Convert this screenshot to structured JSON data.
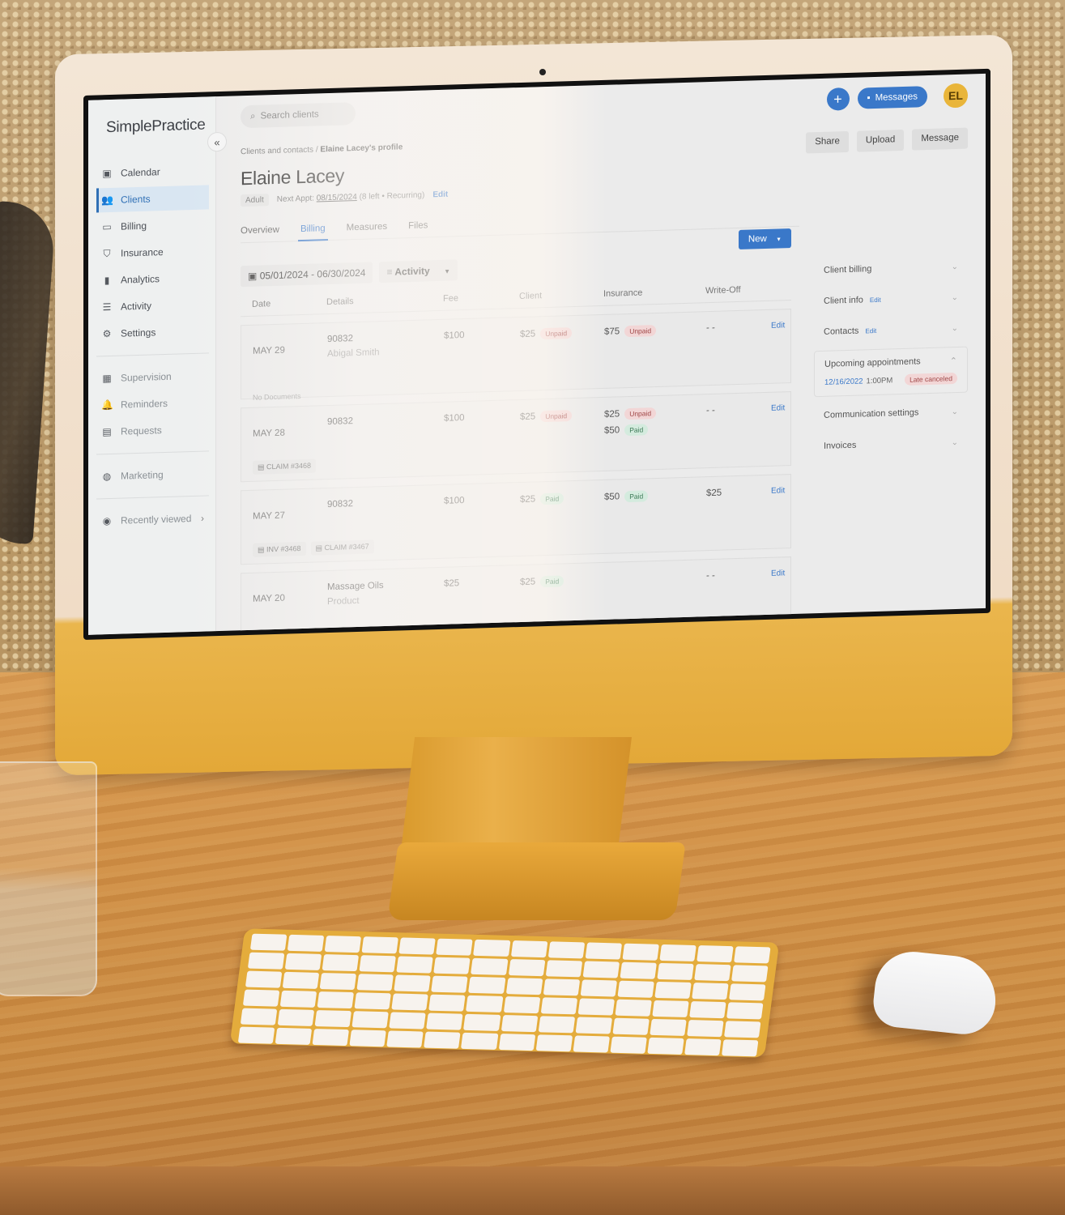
{
  "app": {
    "logo": "SimplePractice",
    "collapse_icon": "«",
    "search_placeholder": "Search clients",
    "add_label": "+",
    "messages_label": "Messages",
    "avatar_initials": "EL"
  },
  "sidebar": {
    "primary": [
      {
        "label": "Calendar",
        "icon": "▣",
        "active": false
      },
      {
        "label": "Clients",
        "icon": "👥",
        "active": true
      },
      {
        "label": "Billing",
        "icon": "▭",
        "active": false
      },
      {
        "label": "Insurance",
        "icon": "⛉",
        "active": false
      },
      {
        "label": "Analytics",
        "icon": "▮",
        "active": false
      },
      {
        "label": "Activity",
        "icon": "☰",
        "active": false
      },
      {
        "label": "Settings",
        "icon": "⚙",
        "active": false
      }
    ],
    "secondary": [
      {
        "label": "Supervision",
        "icon": "▦"
      },
      {
        "label": "Reminders",
        "icon": "🔔"
      },
      {
        "label": "Requests",
        "icon": "▤"
      }
    ],
    "marketing": {
      "label": "Marketing",
      "icon": "◍"
    },
    "recently_viewed": {
      "label": "Recently viewed",
      "icon": "◉",
      "chevron": "›"
    }
  },
  "profile": {
    "breadcrumb": {
      "parent": "Clients and contacts",
      "separator": "/",
      "current": "Elaine Lacey's profile"
    },
    "name": "Elaine Lacey",
    "tag": "Adult",
    "next_appt_label": "Next Appt:",
    "next_appt_date": "08/15/2024",
    "next_appt_note": "(8 left • Recurring)",
    "edit_label": "Edit",
    "actions": {
      "share": "Share",
      "upload": "Upload",
      "message": "Message"
    },
    "tabs": [
      {
        "label": "Overview",
        "active": false
      },
      {
        "label": "Billing",
        "active": true
      },
      {
        "label": "Measures",
        "active": false
      },
      {
        "label": "Files",
        "active": false
      }
    ]
  },
  "billing": {
    "date_range": "05/01/2024 - 06/30/2024",
    "filter_label": "Activity",
    "new_label": "New",
    "columns": [
      "Date",
      "Details",
      "Fee",
      "Client",
      "Insurance",
      "Write-Off",
      ""
    ],
    "rows": [
      {
        "date": "MAY 29",
        "details": "90832",
        "details_sub": "Abigal Smith",
        "fee": "$100",
        "client": [
          {
            "amount": "$25",
            "status": "Unpaid"
          }
        ],
        "insurance": [
          {
            "amount": "$75",
            "status": "Unpaid"
          }
        ],
        "write_off": "- -",
        "edit": "Edit",
        "docs": [],
        "no_docs": "No Documents"
      },
      {
        "date": "MAY 28",
        "details": "90832",
        "details_sub": "",
        "fee": "$100",
        "client": [
          {
            "amount": "$25",
            "status": "Unpaid"
          }
        ],
        "insurance": [
          {
            "amount": "$25",
            "status": "Unpaid"
          },
          {
            "amount": "$50",
            "status": "Paid"
          }
        ],
        "write_off": "- -",
        "edit": "Edit",
        "docs": [
          "CLAIM #3468"
        ],
        "no_docs": ""
      },
      {
        "date": "MAY 27",
        "details": "90832",
        "details_sub": "",
        "fee": "$100",
        "client": [
          {
            "amount": "$25",
            "status": "Paid"
          }
        ],
        "insurance": [
          {
            "amount": "$50",
            "status": "Paid"
          }
        ],
        "write_off": "$25",
        "edit": "Edit",
        "docs": [
          "INV #3468",
          "CLAIM #3467"
        ],
        "no_docs": ""
      },
      {
        "date": "MAY 20",
        "details": "Massage Oils",
        "details_sub": "Product",
        "fee": "$25",
        "client": [
          {
            "amount": "$25",
            "status": "Paid"
          }
        ],
        "insurance": [],
        "write_off": "- -",
        "edit": "Edit",
        "docs": [],
        "no_docs": ""
      }
    ]
  },
  "side_panel": {
    "client_billing": "Client billing",
    "client_info": "Client info",
    "contacts": "Contacts",
    "edit": "Edit",
    "upcoming": {
      "title": "Upcoming appointments",
      "date": "12/16/2022",
      "time": "1:00PM",
      "status": "Late canceled"
    },
    "communication": "Communication settings",
    "invoices": "Invoices",
    "chevron_down": "⌄",
    "chevron_up": "⌃"
  },
  "colors": {
    "accent": "#3a78c9",
    "unpaid_bg": "#f2d6d6",
    "paid_bg": "#d4ebde",
    "avatar": "#e9b53a",
    "imac_yellow": "#e3a838"
  }
}
